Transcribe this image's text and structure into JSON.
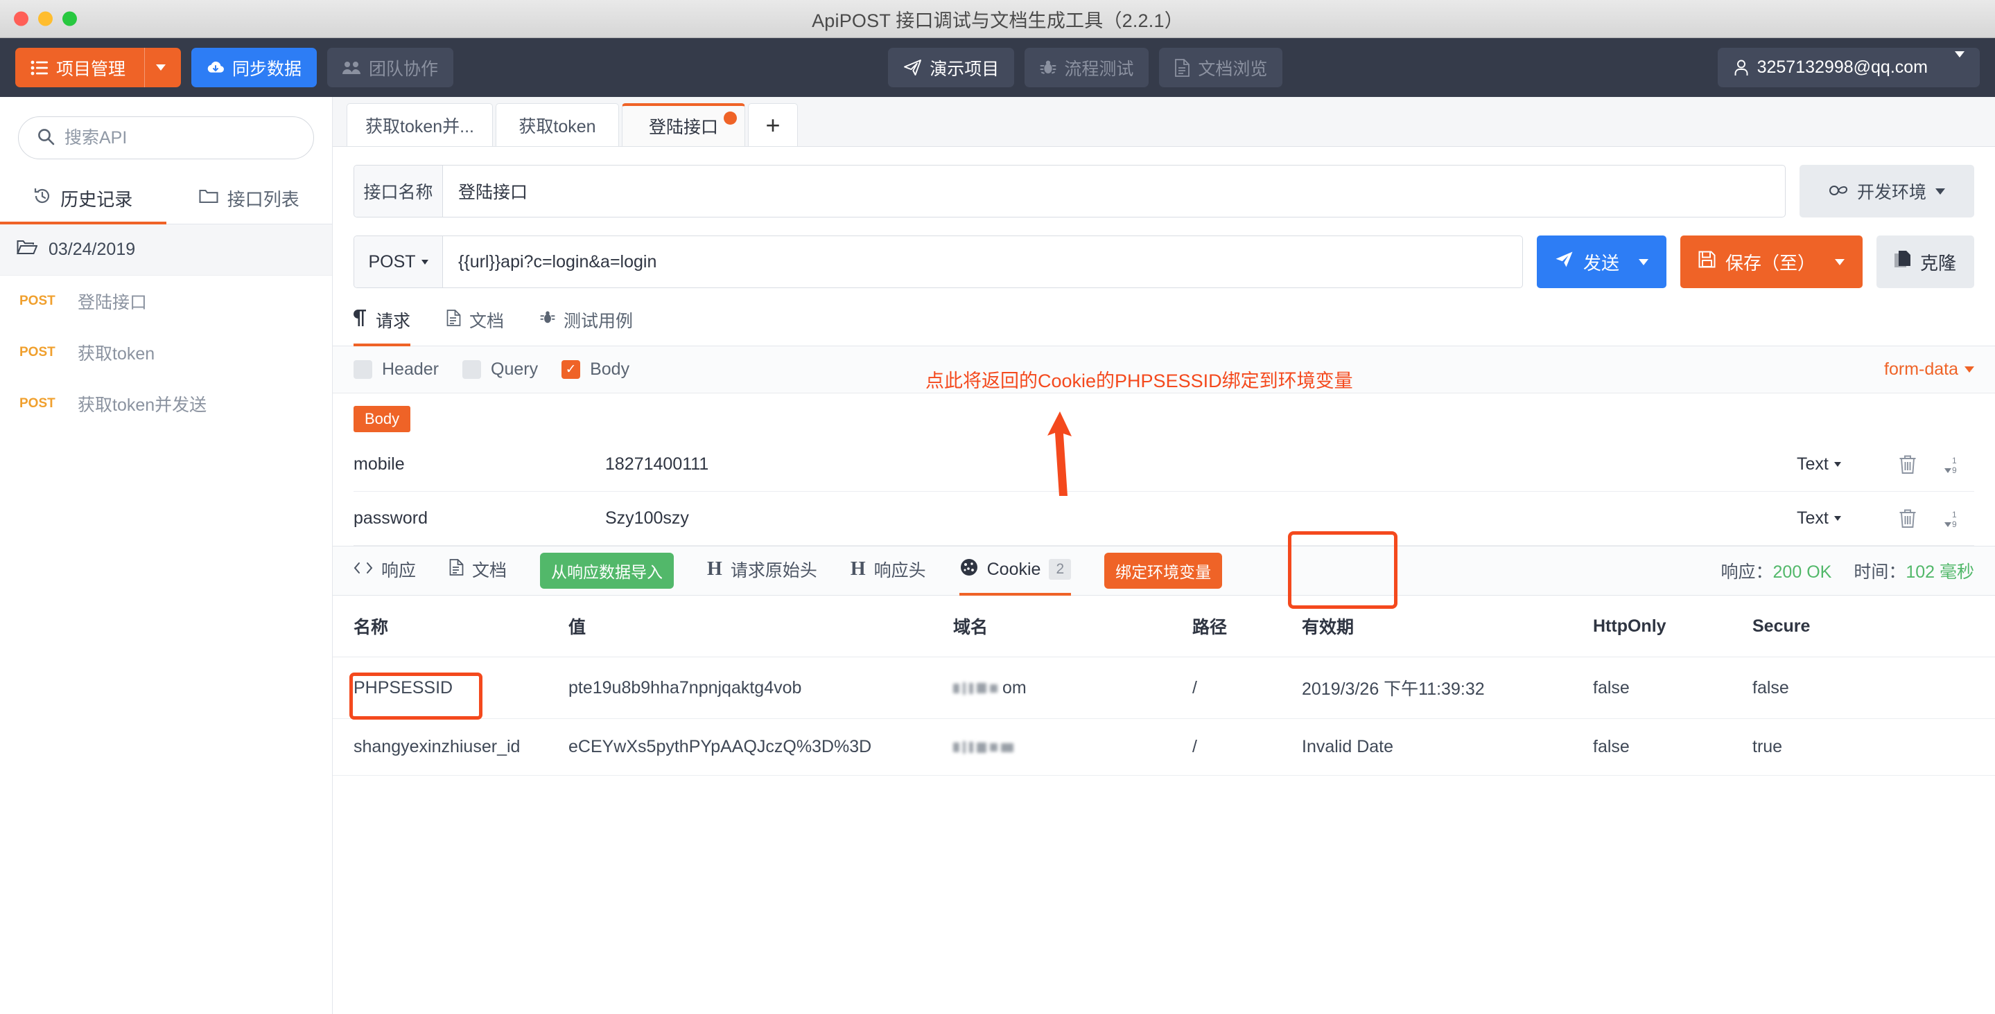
{
  "window": {
    "title": "ApiPOST 接口调试与文档生成工具（2.2.1）"
  },
  "navbar": {
    "project_manage": "项目管理",
    "sync_data": "同步数据",
    "team_collab": "团队协作",
    "demo_project": "演示项目",
    "flow_test": "流程测试",
    "doc_browse": "文档浏览",
    "account": "3257132998@qq.com"
  },
  "sidebar": {
    "search_placeholder": "搜索API",
    "tabs": [
      {
        "label": "历史记录",
        "icon": "history-icon",
        "active": true
      },
      {
        "label": "接口列表",
        "icon": "folder-icon",
        "active": false
      }
    ],
    "folder": "03/24/2019",
    "items": [
      {
        "method": "POST",
        "name": "登陆接口"
      },
      {
        "method": "POST",
        "name": "获取token"
      },
      {
        "method": "POST",
        "name": "获取token并发送"
      }
    ]
  },
  "request_tabs": [
    {
      "label": "获取token并...",
      "active": false,
      "dirty": false
    },
    {
      "label": "获取token",
      "active": false,
      "dirty": false
    },
    {
      "label": "登陆接口",
      "active": true,
      "dirty": true
    }
  ],
  "add_tab_label": "+",
  "api": {
    "name_label": "接口名称",
    "name_value": "登陆接口",
    "env_label": "开发环境",
    "method": "POST",
    "url": "{{url}}api?c=login&a=login",
    "send_label": "发送",
    "save_label": "保存（至）",
    "clone_label": "克隆"
  },
  "req_tabs": [
    {
      "label": "请求",
      "icon": "paragraph-icon",
      "active": true
    },
    {
      "label": "文档",
      "icon": "doc-icon",
      "active": false
    },
    {
      "label": "测试用例",
      "icon": "bug-icon",
      "active": false
    }
  ],
  "param_types": [
    {
      "label": "Header",
      "checked": false
    },
    {
      "label": "Query",
      "checked": false
    },
    {
      "label": "Body",
      "checked": true
    }
  ],
  "body_format": "form-data",
  "body": {
    "tag": "Body",
    "rows": [
      {
        "key": "mobile",
        "value": "18271400111",
        "type": "Text"
      },
      {
        "key": "password",
        "value": "Szy100szy",
        "type": "Text"
      }
    ]
  },
  "annotation": {
    "text": "点此将返回的Cookie的PHPSESSID绑定到环境变量",
    "color": "#f4491d"
  },
  "response": {
    "tabs": [
      {
        "label": "响应",
        "icon": "code-icon",
        "active": false,
        "badge": ""
      },
      {
        "label": "文档",
        "icon": "doc-icon",
        "active": false,
        "badge": ""
      },
      {
        "label": "请求原始头",
        "icon": "h-icon",
        "active": false,
        "badge": ""
      },
      {
        "label": "响应头",
        "icon": "h-icon",
        "active": false,
        "badge": ""
      },
      {
        "label": "Cookie",
        "icon": "cookie-icon",
        "active": true,
        "badge": "2"
      }
    ],
    "import_btn": "从响应数据导入",
    "bind_btn": "绑定环境变量",
    "status_label": "响应：",
    "status_value": "200 OK",
    "time_label": "时间：",
    "time_value": "102 毫秒"
  },
  "cookie_table": {
    "headers": [
      "名称",
      "值",
      "域名",
      "路径",
      "有效期",
      "HttpOnly",
      "Secure"
    ],
    "rows": [
      {
        "name": "PHPSESSID",
        "value": "pte19u8b9hha7npnjqaktg4vob",
        "domain": "om",
        "path": "/",
        "expires": "2019/3/26 下午11:39:32",
        "httponly": "false",
        "secure": "false",
        "highlight": true
      },
      {
        "name": "shangyexinzhiuser_id",
        "value": "eCEYwXs5pythPYpAAQJczQ%3D%3D",
        "domain": "",
        "path": "/",
        "expires": "Invalid Date",
        "httponly": "false",
        "secure": "true",
        "highlight": false
      }
    ]
  }
}
